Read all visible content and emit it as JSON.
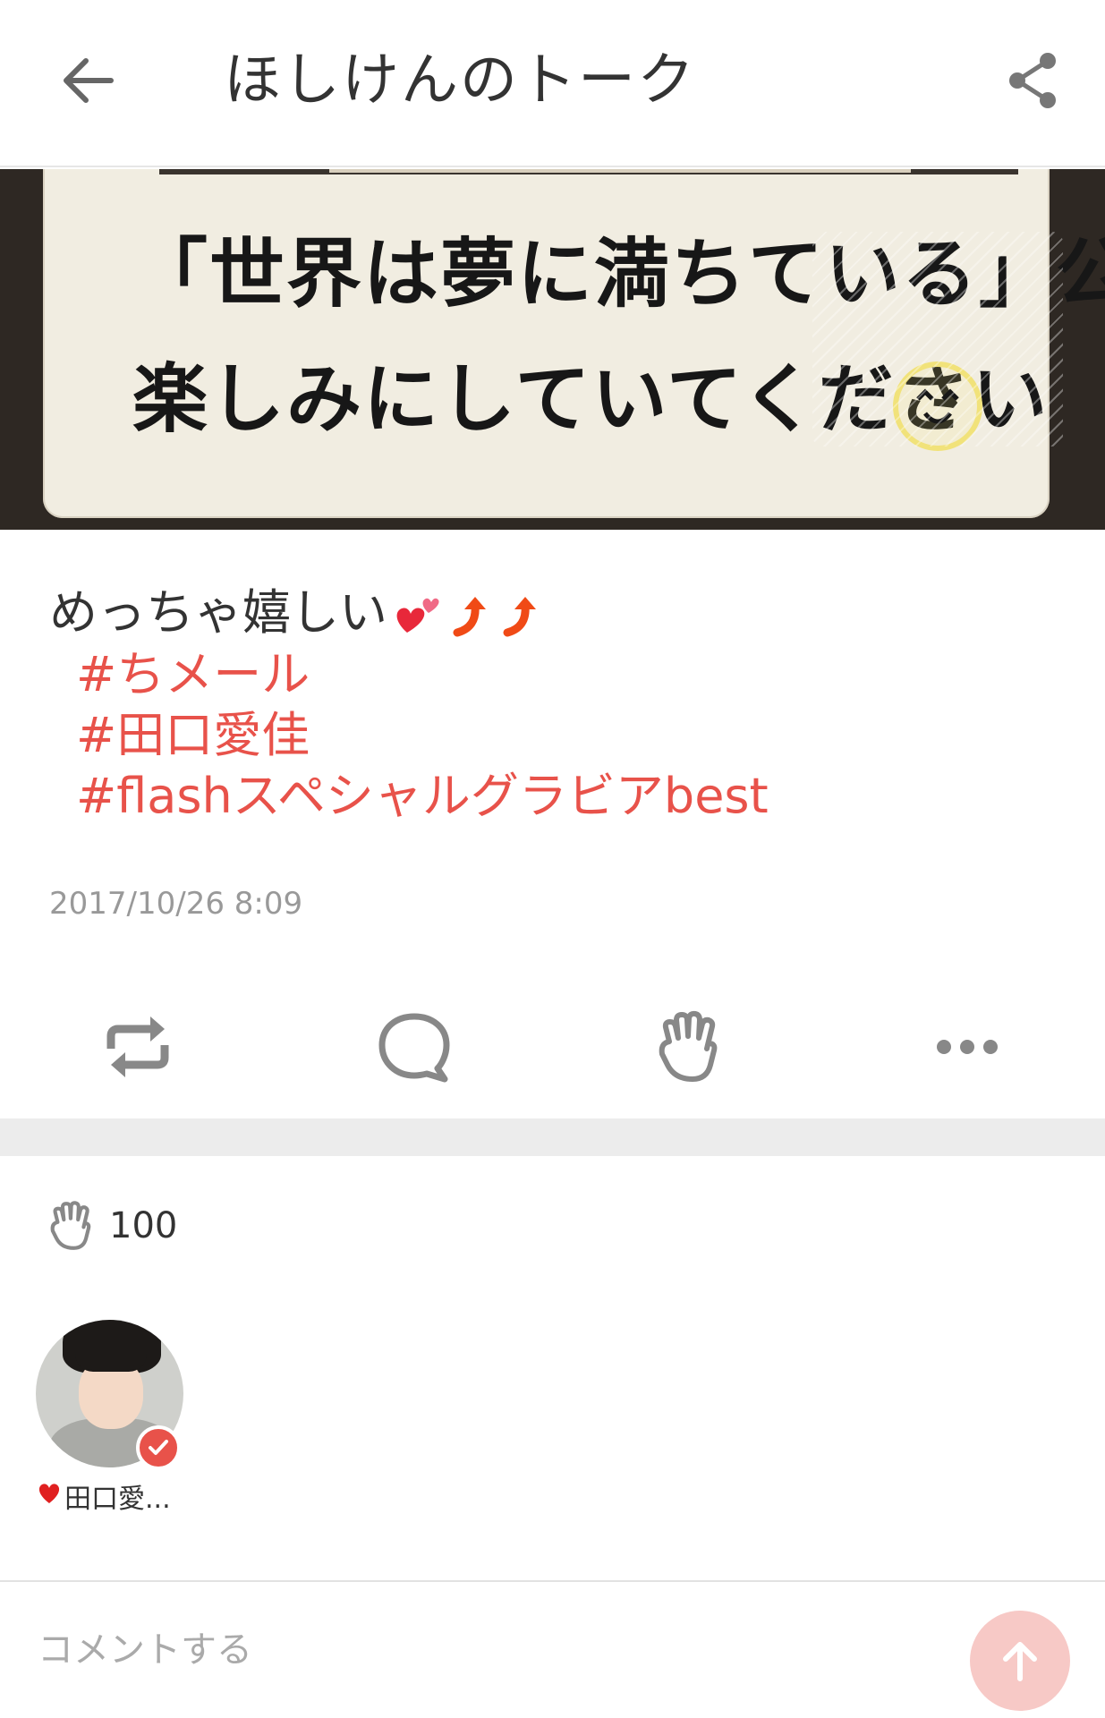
{
  "header": {
    "title": "ほしけんのトーク",
    "back_icon": "arrow-left-icon",
    "share_icon": "share-icon"
  },
  "photo": {
    "line1": "「世界は夢に満ちている」公演",
    "line2": "楽しみにしていてください"
  },
  "post": {
    "text": "めっちゃ嬉しい",
    "emoji": [
      "two-hearts-icon",
      "arrow-up-right-icon",
      "arrow-up-right-icon"
    ],
    "hashtags": [
      "#ちメール",
      "#田口愛佳",
      "#flashスペシャルグラビアbest"
    ],
    "timestamp": "2017/10/26 8:09"
  },
  "actions": {
    "items": [
      "repost-icon",
      "comment-icon",
      "clap-icon",
      "more-icon"
    ]
  },
  "claps": {
    "count": "100"
  },
  "users": [
    {
      "name": "田口愛...",
      "prefix_icon": "heart-icon",
      "verified": true
    }
  ],
  "comment": {
    "placeholder": "コメントする",
    "send_icon": "arrow-up-icon"
  },
  "colors": {
    "accent": "#e8524a",
    "send_button": "#f7c9c6",
    "divider": "#ececec",
    "muted_text": "#999999"
  }
}
